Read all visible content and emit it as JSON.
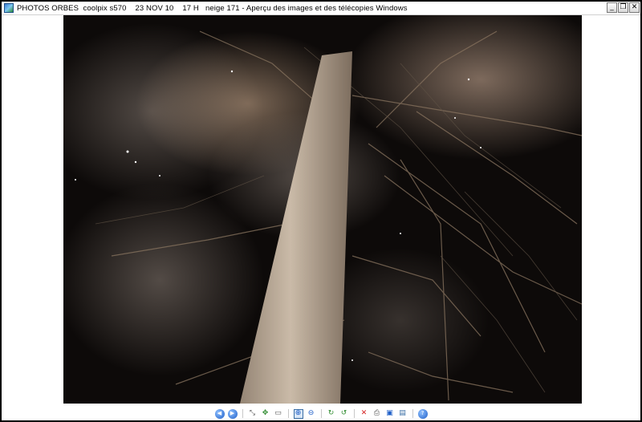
{
  "window": {
    "title": "PHOTOS ORBES  coolpix s570    23 NOV 10    17 H   neige 171 - Aperçu des images et des télécopies Windows",
    "buttons": {
      "minimize": "_",
      "maximize": "❐",
      "close": "✕"
    }
  },
  "toolbar": {
    "buttons": [
      {
        "name": "previous-image-button",
        "icon": "previous-icon",
        "glyph": "◀"
      },
      {
        "name": "next-image-button",
        "icon": "next-icon",
        "glyph": "▶"
      },
      {
        "name": "best-fit-button",
        "icon": "best-fit-icon",
        "glyph": "⤡"
      },
      {
        "name": "actual-size-button",
        "icon": "actual-size-icon",
        "glyph": "✥"
      },
      {
        "name": "slideshow-button",
        "icon": "slideshow-icon",
        "glyph": "▭"
      },
      {
        "name": "zoom-in-button",
        "icon": "zoom-in-icon",
        "glyph": "⊕"
      },
      {
        "name": "zoom-out-button",
        "icon": "zoom-out-icon",
        "glyph": "⊖"
      },
      {
        "name": "rotate-clockwise-button",
        "icon": "rotate-clockwise-icon",
        "glyph": "↻"
      },
      {
        "name": "rotate-counterclockwise-button",
        "icon": "rotate-counterclockwise-icon",
        "glyph": "↺"
      },
      {
        "name": "delete-button",
        "icon": "delete-icon",
        "glyph": "✕"
      },
      {
        "name": "print-button",
        "icon": "print-icon",
        "glyph": "⎙"
      },
      {
        "name": "copy-to-button",
        "icon": "save-icon",
        "glyph": "▣"
      },
      {
        "name": "open-with-button",
        "icon": "open-icon",
        "glyph": "▤"
      },
      {
        "name": "help-button",
        "icon": "help-icon",
        "glyph": "?"
      }
    ]
  },
  "colors": {
    "nav_blue": "#1f5fc8",
    "delete_red": "#d42020",
    "rotate_green": "#2e8b2e"
  }
}
